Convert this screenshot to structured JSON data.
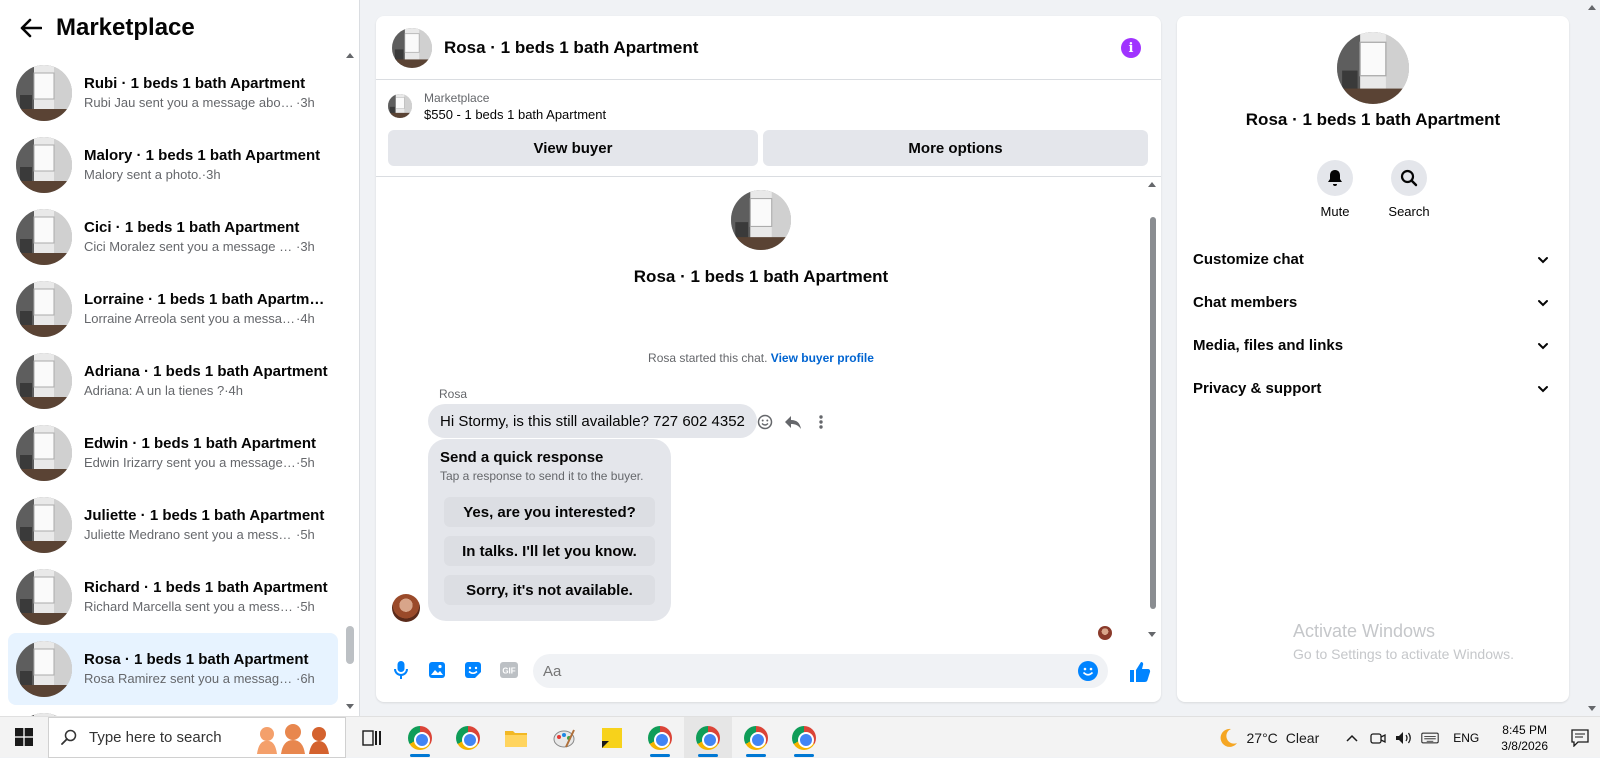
{
  "sidebar": {
    "title": "Marketplace",
    "conversations": [
      {
        "title": "Rubi · 1 beds 1 bath Apartment",
        "snippet": "Rubi Jau sent you a message about...",
        "time": "·3h"
      },
      {
        "title": "Malory · 1 beds 1 bath Apartment",
        "snippet": "Malory sent a photo.",
        "time": "·3h"
      },
      {
        "title": "Cici · 1 beds 1 bath Apartment",
        "snippet": "Cici Moralez sent you a message a...",
        "time": "·3h"
      },
      {
        "title": "Lorraine · 1 beds 1 bath Apartme...",
        "snippet": "Lorraine Arreola sent you a messag...",
        "time": "·4h"
      },
      {
        "title": "Adriana · 1 beds 1 bath Apartment",
        "snippet": "Adriana: A un la tienes ?",
        "time": "·4h"
      },
      {
        "title": "Edwin · 1 beds 1 bath Apartment",
        "snippet": "Edwin Irizarry sent you a message a...",
        "time": "·5h"
      },
      {
        "title": "Juliette · 1 beds 1 bath Apartment",
        "snippet": "Juliette Medrano sent you a messa...",
        "time": "·5h"
      },
      {
        "title": "Richard · 1 beds 1 bath Apartment",
        "snippet": "Richard Marcella sent you a messa...",
        "time": "·5h"
      },
      {
        "title": "Rosa · 1 beds 1 bath Apartment",
        "snippet": "Rosa Ramirez sent you a message a...",
        "time": "·6h"
      }
    ]
  },
  "chat": {
    "title": "Rosa · 1 beds 1 bath Apartment",
    "listing_source": "Marketplace",
    "listing_price": "$550 - 1 beds 1 bath Apartment",
    "view_buyer_label": "View buyer",
    "more_options_label": "More options",
    "intro_name": "Rosa · 1 beds 1 bath Apartment",
    "started_text": "Rosa started this chat.",
    "view_buyer_profile_link": "View buyer profile",
    "sender_name": "Rosa",
    "message": "Hi Stormy, is this still available? 727 602 4352",
    "quick_response": {
      "title": "Send a quick response",
      "subtitle": "Tap a response to send it to the buyer.",
      "options": [
        "Yes, are you interested?",
        "In talks. I'll let you know.",
        "Sorry, it's not available."
      ]
    },
    "composer_placeholder": "Aa"
  },
  "details": {
    "name": "Rosa · 1 beds 1 bath Apartment",
    "mute_label": "Mute",
    "search_label": "Search",
    "sections": [
      "Customize chat",
      "Chat members",
      "Media, files and links",
      "Privacy & support"
    ],
    "watermark_title": "Activate Windows",
    "watermark_sub": "Go to Settings to activate Windows."
  },
  "taskbar": {
    "search_placeholder": "Type here to search",
    "weather_temp": "27°C",
    "weather_desc": "Clear",
    "language": "ENG",
    "time": "8:45 PM",
    "date": "3/8/2026"
  },
  "colors": {
    "accent": "#0084ff",
    "info": "#a033ff",
    "active_conversation": "#e7f3ff",
    "link": "#0064d1"
  }
}
